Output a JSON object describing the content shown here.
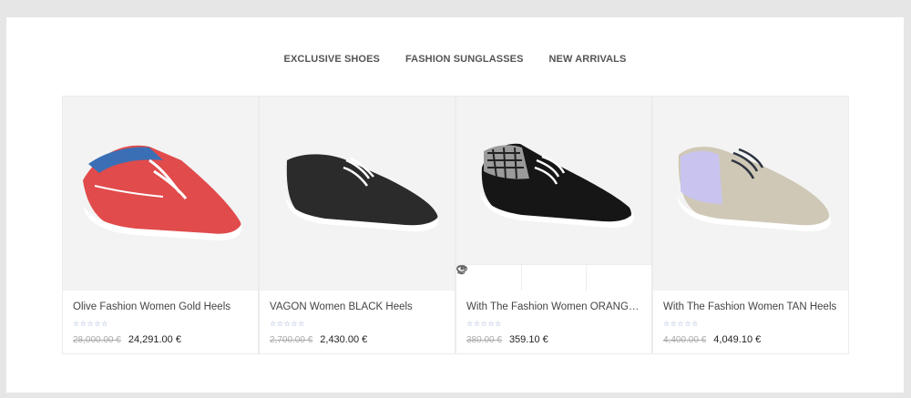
{
  "tabs": [
    "EXCLUSIVE SHOES",
    "FASHION SUNGLASSES",
    "NEW ARRIVALS"
  ],
  "products": [
    {
      "title": "Olive Fashion Women Gold Heels",
      "rating_stars": "☆☆☆☆☆",
      "old_price": "28,000.00 €",
      "price": "24,291.00 €",
      "image": "red-boat-shoe"
    },
    {
      "title": "VAGON Women BLACK Heels",
      "rating_stars": "☆☆☆☆☆",
      "old_price": "2,700.00 €",
      "price": "2,430.00 €",
      "image": "black-canvas-shoe"
    },
    {
      "title": "With The Fashion Women ORANGE Heels",
      "rating_stars": "☆☆☆☆☆",
      "old_price": "380.00 €",
      "price": "359.10 €",
      "image": "black-houndstooth-sneaker",
      "actions": [
        "eye-icon",
        "heart-icon",
        "refresh-icon"
      ]
    },
    {
      "title": "With The Fashion Women TAN Heels",
      "rating_stars": "☆☆☆☆☆",
      "old_price": "4,400.00 €",
      "price": "4,049.10 €",
      "image": "tan-lavender-sneaker"
    }
  ],
  "colors": {
    "page_bg": "#e6e6e6",
    "card_image_bg": "#f3f3f3",
    "tab_text": "#555555",
    "star": "#8fa3cc"
  }
}
